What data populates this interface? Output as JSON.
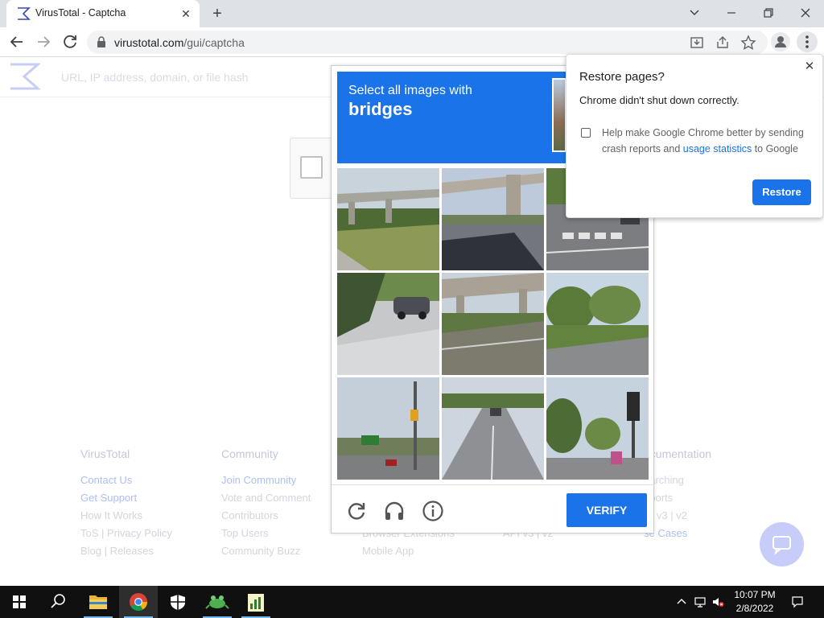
{
  "tab": {
    "title": "VirusTotal - Captcha",
    "close_glyph": "✕",
    "new_tab_glyph": "+"
  },
  "window_controls": [
    "chevron-down-icon",
    "minimize-icon",
    "restore-icon",
    "close-icon"
  ],
  "toolbar": {
    "url_host": "virustotal.com",
    "url_path": "/gui/captcha"
  },
  "vt": {
    "search_placeholder": "URL, IP address, domain, or file hash",
    "footer": [
      {
        "heading": "VirusTotal",
        "links": [
          {
            "text": "Contact Us",
            "blue": true
          },
          {
            "text": "Get Support",
            "blue": true
          },
          {
            "text": "How It Works",
            "blue": false
          },
          {
            "text": "ToS | Privacy Policy",
            "blue": false
          },
          {
            "text": "Blog | Releases",
            "blue": false
          }
        ]
      },
      {
        "heading": "Community",
        "links": [
          {
            "text": "Join Community",
            "blue": true
          },
          {
            "text": "Vote and Comment",
            "blue": false
          },
          {
            "text": "Contributors",
            "blue": false
          },
          {
            "text": "Top Users",
            "blue": false
          },
          {
            "text": "Community Buzz",
            "blue": false
          }
        ]
      },
      {
        "heading": "",
        "links": [
          {
            "text": "",
            "blue": false
          },
          {
            "text": "",
            "blue": false
          },
          {
            "text": "",
            "blue": false
          },
          {
            "text": "Browser Extensions",
            "blue": false
          },
          {
            "text": "Mobile App",
            "blue": false
          }
        ]
      },
      {
        "heading": "",
        "links": [
          {
            "text": "",
            "blue": false
          },
          {
            "text": "",
            "blue": false
          },
          {
            "text": "",
            "blue": false
          },
          {
            "text": "API v3 | v2",
            "blue": false
          },
          {
            "text": "",
            "blue": false
          }
        ]
      },
      {
        "heading": "ocumentation",
        "links": [
          {
            "text": "earching",
            "blue": false
          },
          {
            "text": "eports",
            "blue": false
          },
          {
            "text": "PI v3 | v2",
            "blue": false
          },
          {
            "text": "se Cases",
            "blue": true
          },
          {
            "text": "",
            "blue": false
          }
        ]
      }
    ]
  },
  "captcha": {
    "instruction": "Select all images with",
    "keyword": "bridges",
    "verify_label": "VERIFY",
    "tiles": [
      {
        "desc": "overpass-over-grass"
      },
      {
        "desc": "overpass-pillar-parking"
      },
      {
        "desc": "crosswalk-street"
      },
      {
        "desc": "car-driveway"
      },
      {
        "desc": "overpass-highway"
      },
      {
        "desc": "trees-lawn-road"
      },
      {
        "desc": "traffic-signs-street"
      },
      {
        "desc": "road-intersection"
      },
      {
        "desc": "traffic-light-trees"
      }
    ]
  },
  "restore": {
    "title": "Restore pages?",
    "body": "Chrome didn't shut down correctly.",
    "checkbox_text_before": "Help make Google Chrome better by sending crash reports and ",
    "checkbox_link": "usage statistics",
    "checkbox_text_after": " to Google",
    "button": "Restore"
  },
  "taskbar": {
    "apps": [
      "start-icon",
      "search-icon",
      "file-explorer-icon",
      "chrome-icon",
      "shield-app-icon",
      "frog-app-icon",
      "chart-app-icon"
    ],
    "time": "10:07 PM",
    "date": "2/8/2022"
  },
  "colors": {
    "accent": "#1a73e8",
    "tabstrip": "#dee1e6",
    "taskbar": "#101010"
  }
}
